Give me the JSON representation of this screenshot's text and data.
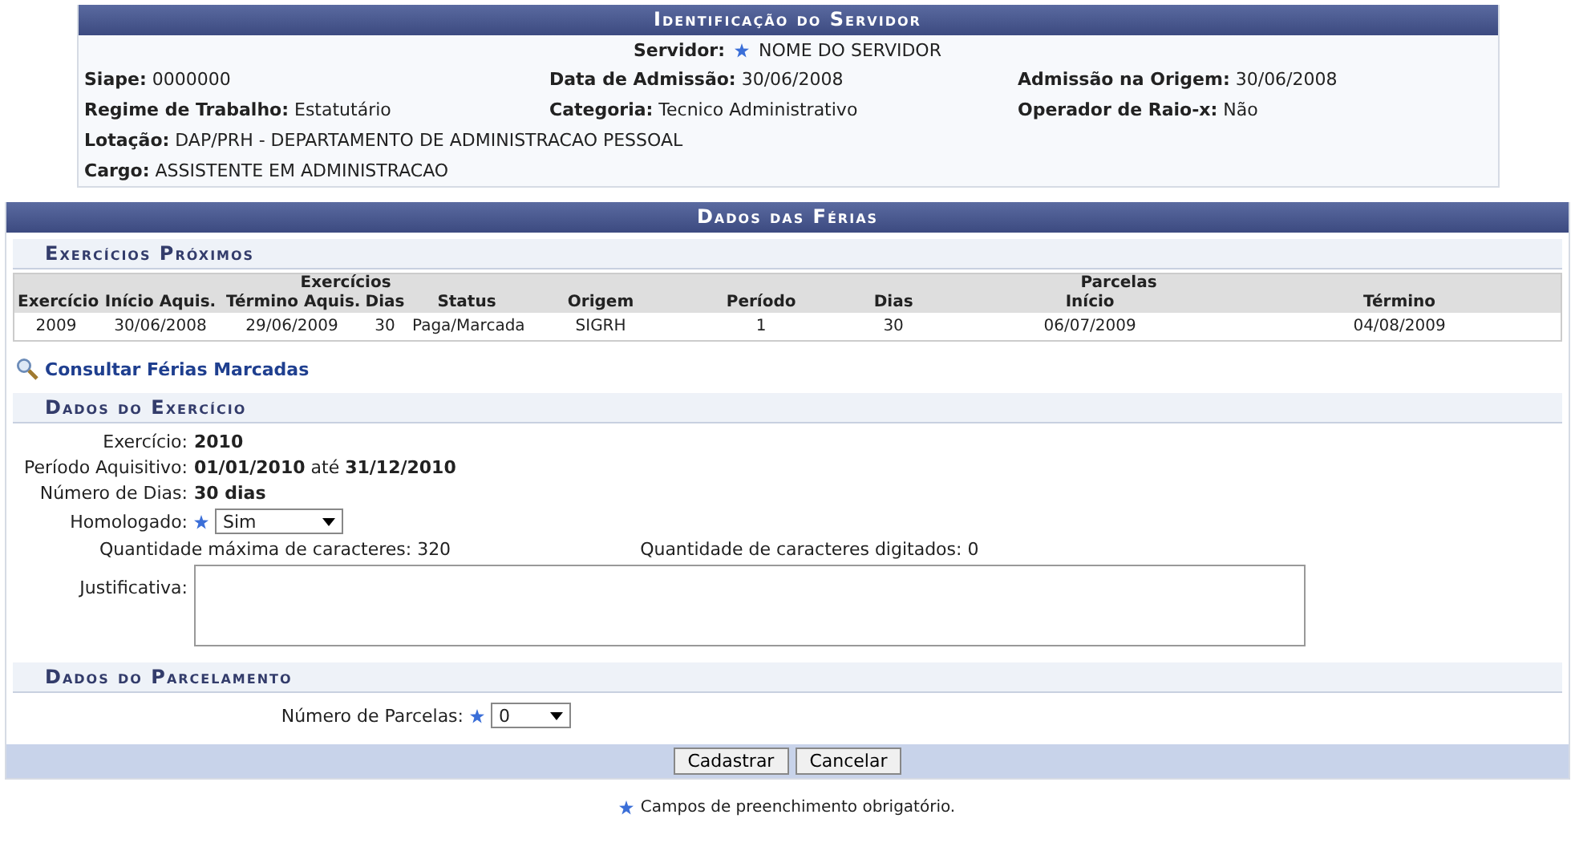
{
  "servidor_panel": {
    "title": "Identificação do Servidor",
    "servidor": {
      "label": "Servidor:",
      "value": "NOME DO SERVIDOR",
      "required": true
    },
    "rows": [
      [
        {
          "label": "Siape:",
          "value": "0000000"
        },
        {
          "label": "Data de Admissão:",
          "value": "30/06/2008"
        },
        {
          "label": "Admissão na Origem:",
          "value": "30/06/2008"
        }
      ],
      [
        {
          "label": "Regime de Trabalho:",
          "value": "Estatutário"
        },
        {
          "label": "Categoria:",
          "value": "Tecnico Administrativo"
        },
        {
          "label": "Operador de Raio-x:",
          "value": "Não"
        }
      ],
      [
        {
          "label": "Lotação:",
          "value": "DAP/PRH - DEPARTAMENTO DE ADMINISTRACAO PESSOAL"
        }
      ],
      [
        {
          "label": "Cargo:",
          "value": "ASSISTENTE EM ADMINISTRACAO"
        }
      ]
    ]
  },
  "ferias_panel": {
    "title": "Dados das Férias",
    "proximos": {
      "title": "Exercícios Próximos",
      "groups": [
        {
          "label": "Exercícios",
          "columns": [
            "Exercício",
            "Início Aquis.",
            "Término Aquis.",
            "Dias",
            "Status",
            "Origem"
          ]
        },
        {
          "label": "Parcelas",
          "columns": [
            "Período",
            "Dias",
            "Início",
            "Término"
          ]
        }
      ],
      "rows": [
        [
          "2009",
          "30/06/2008",
          "29/06/2009",
          "30",
          "Paga/Marcada",
          "SIGRH",
          "1",
          "30",
          "06/07/2009",
          "04/08/2009"
        ]
      ]
    },
    "link": "Consultar Férias Marcadas",
    "exercicio": {
      "title": "Dados do Exercício",
      "fields": [
        {
          "kind": "text",
          "label": "Exercício:",
          "value": "**2010**"
        },
        {
          "kind": "text",
          "label": "Período Aquisitivo:",
          "value": "**01/01/2010** até **31/12/2010**"
        },
        {
          "kind": "text",
          "label": "Número de Dias:",
          "value": "**30 dias**"
        },
        {
          "kind": "select",
          "label": "Homologado:",
          "value": "Sim",
          "required": true
        },
        {
          "kind": "counters",
          "max": "Quantidade máxima de caracteres: 320",
          "typed": "Quantidade de caracteres digitados: 0"
        },
        {
          "kind": "textarea",
          "label": "Justificativa:"
        }
      ]
    },
    "parcelamento": {
      "title": "Dados do Parcelamento",
      "field": {
        "label": "Número de Parcelas:",
        "value": "0",
        "required": true
      }
    },
    "buttons": [
      "Cadastrar",
      "Cancelar"
    ]
  },
  "footnote": "Campos de preenchimento obrigatório."
}
